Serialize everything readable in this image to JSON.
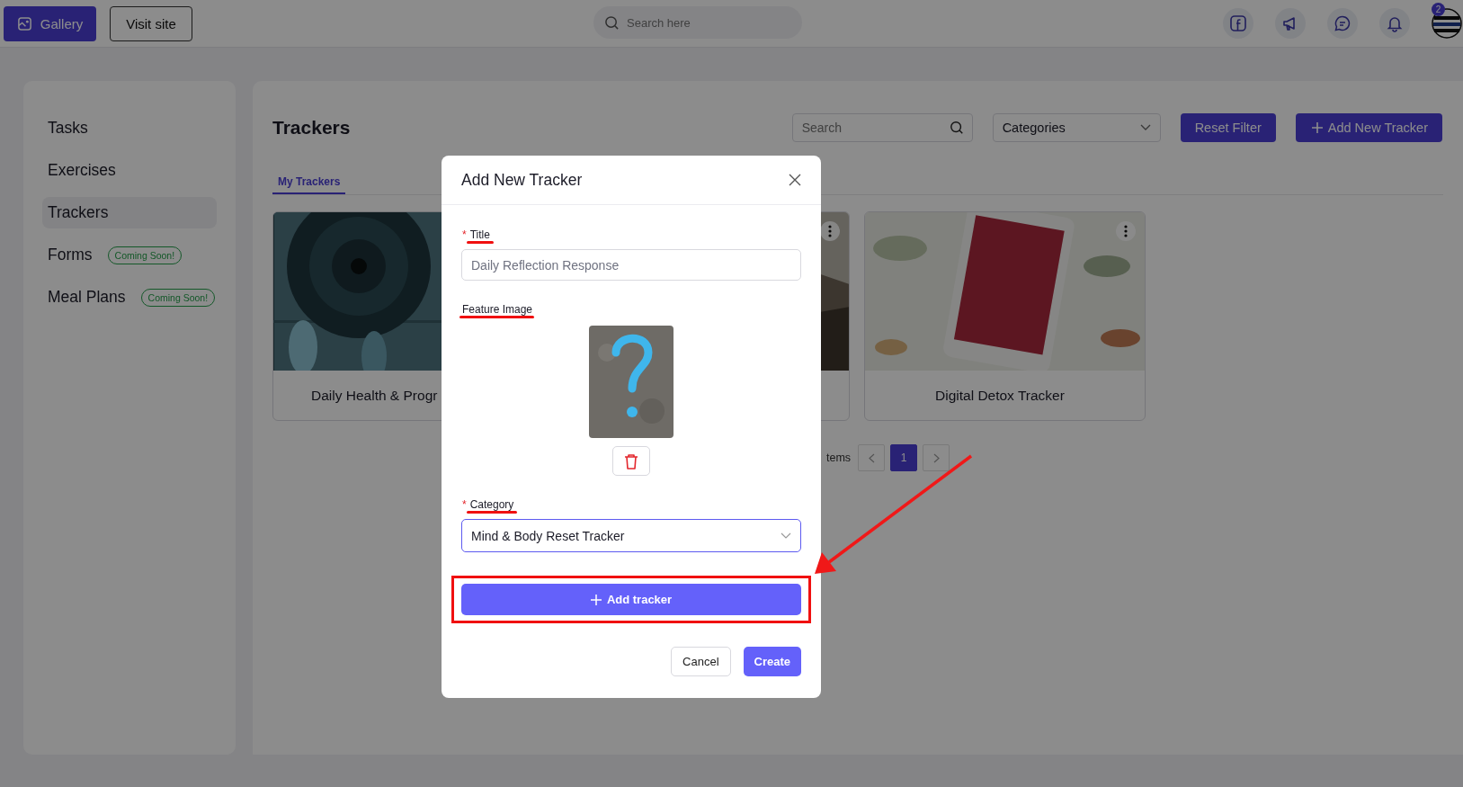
{
  "topbar": {
    "gallery_button": "Gallery",
    "visit_site_button": "Visit site",
    "search": {
      "placeholder": "Search here"
    },
    "notification_count": "2"
  },
  "sidebar": {
    "items": [
      {
        "label": "Tasks",
        "selected": false
      },
      {
        "label": "Exercises",
        "selected": false
      },
      {
        "label": "Trackers",
        "selected": true
      },
      {
        "label": "Forms",
        "selected": false,
        "badge": "Coming Soon!"
      },
      {
        "label": "Meal Plans",
        "selected": false,
        "badge": "Coming Soon!"
      }
    ]
  },
  "main": {
    "title": "Trackers",
    "search": {
      "placeholder": "Search"
    },
    "category_filter": "Categories",
    "reset_button": "Reset Filter",
    "add_button": "Add New Tracker",
    "tabs": [
      {
        "label": "My Trackers",
        "selected": true
      }
    ],
    "cards": [
      {
        "title": "Daily Health & Progr",
        "kind": "picture"
      },
      {
        "kind": "picture",
        "menu": true
      },
      {
        "title": "Digital Detox Tracker",
        "kind": "picture",
        "menu": true
      }
    ],
    "pagination": {
      "total_text": "tems",
      "pages": [
        {
          "label": "1",
          "selected": true
        }
      ]
    }
  },
  "modal": {
    "title": "Add New Tracker",
    "fields": [
      {
        "kind": "text",
        "label": "Title",
        "required_mark": "*",
        "placeholder": "Daily Reflection Response",
        "underlined": true
      },
      {
        "label": "Feature Image",
        "underlined": true
      },
      {
        "kind": "select",
        "label": "Category",
        "required_mark": "*",
        "value": "Mind & Body Reset Tracker",
        "underlined": true
      }
    ],
    "add_button": {
      "label": "Add tracker",
      "highlighted": true
    },
    "buttons": [
      {
        "label": "Cancel",
        "kind": "secondary"
      },
      {
        "label": "Create",
        "kind": "primary"
      }
    ]
  },
  "annotation_arrow": true
}
